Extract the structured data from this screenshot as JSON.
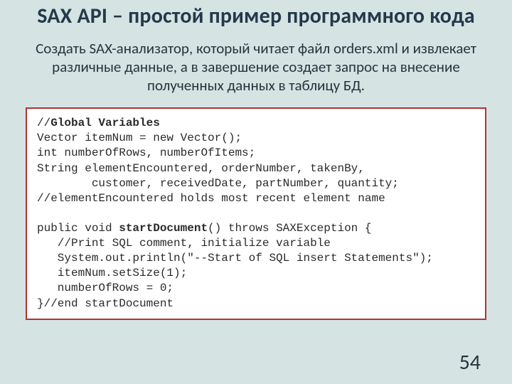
{
  "title": "SAX API – простой пример программного кода",
  "description": "Создать SAX-анализатор, который читает файл orders.xml и извлекает различные данные, а в завершение создает запрос на внесение полученных данных в таблицу БД.",
  "code": {
    "l01a": "//",
    "l01b": "Global Variables",
    "l02": "Vector itemNum = new Vector();",
    "l03": "int numberOfRows, numberOfItems;",
    "l04": "String elementEncountered, orderNumber, takenBy,",
    "l05": "        customer, receivedDate, partNumber, quantity;",
    "l06": "//elementEncountered holds most recent element name",
    "l07": "",
    "l08a": "public void ",
    "l08b": "startDocument",
    "l08c": "() throws SAXException {",
    "l09": "   //Print SQL comment, initialize variable",
    "l10": "   System.out.println(\"--Start of SQL insert Statements\");",
    "l11": "   itemNum.setSize(1);",
    "l12": "   numberOfRows = 0;",
    "l13": "}//end startDocument"
  },
  "pageNumber": "54"
}
